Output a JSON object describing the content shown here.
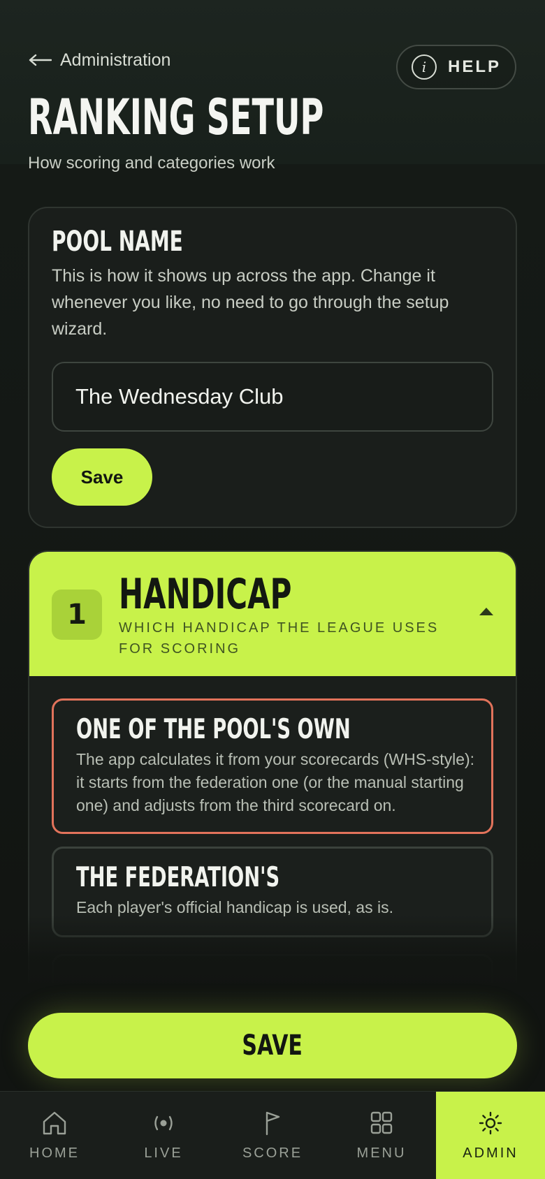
{
  "header": {
    "back_label": "Administration",
    "help_label": "HELP",
    "help_icon_glyph": "i",
    "title": "RANKING SETUP",
    "subtitle": "How scoring and categories work"
  },
  "pool_name_card": {
    "title": "POOL NAME",
    "description": "This is how it shows up across the app. Change it whenever you like, no need to go through the setup wizard.",
    "input_value": "The Wednesday Club",
    "save_label": "Save"
  },
  "handicap_section": {
    "step_number": "1",
    "title": "HANDICAP",
    "subtitle": "WHICH HANDICAP THE LEAGUE USES FOR SCORING",
    "expanded": true,
    "options": [
      {
        "title": "ONE OF THE POOL'S OWN",
        "description": "The app calculates it from your scorecards (WHS-style): it starts from the federation one (or the manual starting one) and adjusts from the third scorecard on.",
        "selected": true
      },
      {
        "title": "THE FEDERATION'S",
        "description": "Each player's official handicap is used, as is.",
        "selected": false
      }
    ]
  },
  "save_button_label": "SAVE",
  "bottom_nav": [
    {
      "label": "HOME",
      "icon": "home-icon",
      "active": false
    },
    {
      "label": "LIVE",
      "icon": "live-icon",
      "active": false
    },
    {
      "label": "SCORE",
      "icon": "flag-icon",
      "active": false
    },
    {
      "label": "MENU",
      "icon": "grid-icon",
      "active": false
    },
    {
      "label": "ADMIN",
      "icon": "sun-gear-icon",
      "active": true
    }
  ],
  "colors": {
    "accent": "#c8f24a",
    "background": "#141815",
    "selected_border": "#e2735b"
  }
}
